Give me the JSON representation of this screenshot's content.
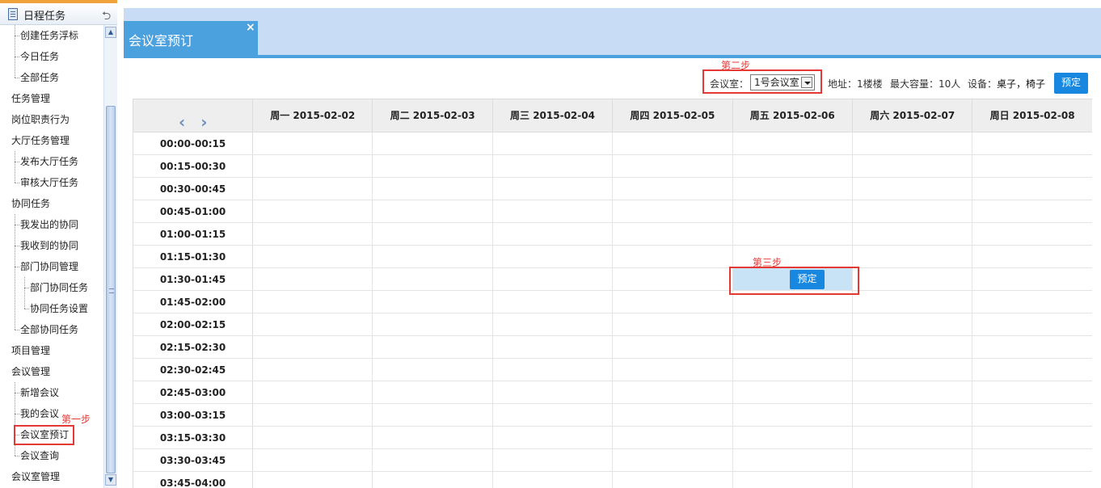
{
  "sidebar": {
    "header_title": "日程任务",
    "items": [
      {
        "label": "创建任务浮标",
        "level": 1
      },
      {
        "label": "今日任务",
        "level": 1
      },
      {
        "label": "全部任务",
        "level": 1
      },
      {
        "label": "任务管理",
        "level": 0
      },
      {
        "label": "岗位职责行为",
        "level": 0
      },
      {
        "label": "大厅任务管理",
        "level": 0
      },
      {
        "label": "发布大厅任务",
        "level": 1
      },
      {
        "label": "审核大厅任务",
        "level": 1
      },
      {
        "label": "协同任务",
        "level": 0
      },
      {
        "label": "我发出的协同",
        "level": 1
      },
      {
        "label": "我收到的协同",
        "level": 1
      },
      {
        "label": "部门协同管理",
        "level": 1
      },
      {
        "label": "部门协同任务",
        "level": 2
      },
      {
        "label": "协同任务设置",
        "level": 2
      },
      {
        "label": "全部协同任务",
        "level": 1
      },
      {
        "label": "项目管理",
        "level": 0
      },
      {
        "label": "会议管理",
        "level": 0
      },
      {
        "label": "新增会议",
        "level": 1
      },
      {
        "label": "我的会议",
        "level": 1
      },
      {
        "label": "会议室预订",
        "level": 1
      },
      {
        "label": "会议查询",
        "level": 1
      },
      {
        "label": "会议室管理",
        "level": 0
      }
    ],
    "step1_label": "第一步"
  },
  "tab": {
    "title": "会议室预订",
    "close": "×"
  },
  "toolbar": {
    "step2_label": "第二步",
    "room_label": "会议室：",
    "room_value": "1号会议室",
    "address": "地址：1楼楼",
    "capacity": "最大容量：10人",
    "equipment_label": "设备：",
    "equipment_value": "桌子，椅子",
    "book_button": "预定"
  },
  "calendar": {
    "nav": "‹ ›",
    "days": [
      {
        "weekday": "周一",
        "date": "2015-02-02"
      },
      {
        "weekday": "周二",
        "date": "2015-02-03"
      },
      {
        "weekday": "周三",
        "date": "2015-02-04"
      },
      {
        "weekday": "周四",
        "date": "2015-02-05"
      },
      {
        "weekday": "周五",
        "date": "2015-02-06"
      },
      {
        "weekday": "周六",
        "date": "2015-02-07"
      },
      {
        "weekday": "周日",
        "date": "2015-02-08"
      }
    ],
    "slots": [
      "00:00-00:15",
      "00:15-00:30",
      "00:30-00:45",
      "00:45-01:00",
      "01:00-01:15",
      "01:15-01:30",
      "01:30-01:45",
      "01:45-02:00",
      "02:00-02:15",
      "02:15-02:30",
      "02:30-02:45",
      "02:45-03:00",
      "03:00-03:15",
      "03:15-03:30",
      "03:30-03:45",
      "03:45-04:00"
    ],
    "selected": {
      "day": "周五",
      "slot": "01:30-01:45"
    },
    "step3_label": "第三步",
    "cell_button": "预定"
  },
  "colors": {
    "accent": "#4ba0de",
    "button": "#1787e0",
    "annotation": "#e53935",
    "selection": "#c8e2f6"
  }
}
